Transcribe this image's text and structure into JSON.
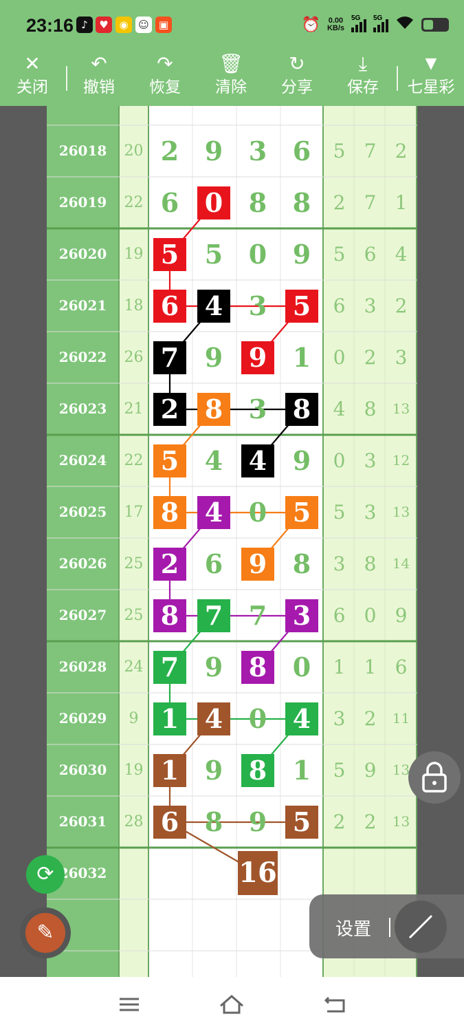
{
  "status_bar": {
    "time": "23:16",
    "net_speed": "0.00",
    "net_unit": "KB/s",
    "sim1": "5G",
    "sim2": "5G",
    "app_icons": [
      "tiktok-icon",
      "heart-app-icon",
      "bell-app-icon",
      "avatar-app-icon",
      "shopping-app-icon"
    ]
  },
  "toolbar": {
    "close": "关闭",
    "undo": "撤销",
    "redo": "恢复",
    "clear": "清除",
    "share": "分享",
    "save": "保存",
    "lottery": "七星彩"
  },
  "chart": {
    "rows": [
      {
        "issue": "26018",
        "sum": "20",
        "digits": [
          "2",
          "9",
          "3",
          "6"
        ],
        "tail": [
          "5",
          "7",
          "2"
        ]
      },
      {
        "issue": "26019",
        "sum": "22",
        "digits": [
          "6",
          "0",
          "8",
          "8"
        ],
        "tail": [
          "2",
          "7",
          "1"
        ]
      },
      {
        "issue": "26020",
        "sum": "19",
        "digits": [
          "5",
          "5",
          "0",
          "9"
        ],
        "tail": [
          "5",
          "6",
          "4"
        ]
      },
      {
        "issue": "26021",
        "sum": "18",
        "digits": [
          "6",
          "4",
          "3",
          "5"
        ],
        "tail": [
          "6",
          "3",
          "2"
        ]
      },
      {
        "issue": "26022",
        "sum": "26",
        "digits": [
          "7",
          "9",
          "9",
          "1"
        ],
        "tail": [
          "0",
          "2",
          "3"
        ]
      },
      {
        "issue": "26023",
        "sum": "21",
        "digits": [
          "2",
          "8",
          "3",
          "8"
        ],
        "tail": [
          "4",
          "8",
          "13"
        ]
      },
      {
        "issue": "26024",
        "sum": "22",
        "digits": [
          "5",
          "4",
          "4",
          "9"
        ],
        "tail": [
          "0",
          "3",
          "12"
        ]
      },
      {
        "issue": "26025",
        "sum": "17",
        "digits": [
          "8",
          "4",
          "0",
          "5"
        ],
        "tail": [
          "5",
          "3",
          "13"
        ]
      },
      {
        "issue": "26026",
        "sum": "25",
        "digits": [
          "2",
          "6",
          "9",
          "8"
        ],
        "tail": [
          "3",
          "8",
          "14"
        ]
      },
      {
        "issue": "26027",
        "sum": "25",
        "digits": [
          "8",
          "7",
          "7",
          "3"
        ],
        "tail": [
          "6",
          "0",
          "9"
        ]
      },
      {
        "issue": "26028",
        "sum": "24",
        "digits": [
          "7",
          "9",
          "8",
          "0"
        ],
        "tail": [
          "1",
          "1",
          "6"
        ]
      },
      {
        "issue": "26029",
        "sum": "9",
        "digits": [
          "1",
          "4",
          "0",
          "4"
        ],
        "tail": [
          "3",
          "2",
          "11"
        ]
      },
      {
        "issue": "26030",
        "sum": "19",
        "digits": [
          "1",
          "9",
          "8",
          "1"
        ],
        "tail": [
          "5",
          "9",
          "13"
        ]
      },
      {
        "issue": "26031",
        "sum": "28",
        "digits": [
          "6",
          "8",
          "9",
          "5"
        ],
        "tail": [
          "2",
          "2",
          "13"
        ]
      },
      {
        "issue": "26032",
        "sum": "",
        "digits": [
          "",
          "",
          "",
          ""
        ],
        "tail": [
          "",
          "",
          ""
        ]
      }
    ],
    "highlights": [
      {
        "row": 1,
        "col": 1,
        "color": "#e8141c"
      },
      {
        "row": 2,
        "col": 0,
        "color": "#e8141c"
      },
      {
        "row": 3,
        "col": 0,
        "color": "#e8141c"
      },
      {
        "row": 3,
        "col": 3,
        "color": "#e8141c"
      },
      {
        "row": 4,
        "col": 2,
        "color": "#e8141c"
      },
      {
        "row": 3,
        "col": 1,
        "color": "#000000"
      },
      {
        "row": 4,
        "col": 0,
        "color": "#000000"
      },
      {
        "row": 5,
        "col": 0,
        "color": "#000000"
      },
      {
        "row": 5,
        "col": 3,
        "color": "#000000"
      },
      {
        "row": 6,
        "col": 2,
        "color": "#000000"
      },
      {
        "row": 5,
        "col": 1,
        "color": "#f77d16"
      },
      {
        "row": 6,
        "col": 0,
        "color": "#f77d16"
      },
      {
        "row": 7,
        "col": 0,
        "color": "#f77d16"
      },
      {
        "row": 7,
        "col": 3,
        "color": "#f77d16"
      },
      {
        "row": 8,
        "col": 2,
        "color": "#f77d16"
      },
      {
        "row": 7,
        "col": 1,
        "color": "#a51aac"
      },
      {
        "row": 8,
        "col": 0,
        "color": "#a51aac"
      },
      {
        "row": 9,
        "col": 0,
        "color": "#a51aac"
      },
      {
        "row": 9,
        "col": 3,
        "color": "#a51aac"
      },
      {
        "row": 10,
        "col": 2,
        "color": "#a51aac"
      },
      {
        "row": 9,
        "col": 1,
        "color": "#26b14a"
      },
      {
        "row": 10,
        "col": 0,
        "color": "#26b14a"
      },
      {
        "row": 11,
        "col": 0,
        "color": "#26b14a"
      },
      {
        "row": 11,
        "col": 3,
        "color": "#26b14a"
      },
      {
        "row": 12,
        "col": 2,
        "color": "#26b14a"
      },
      {
        "row": 11,
        "col": 1,
        "color": "#a0552b"
      },
      {
        "row": 12,
        "col": 0,
        "color": "#a0552b"
      },
      {
        "row": 13,
        "col": 0,
        "color": "#a0552b"
      },
      {
        "row": 13,
        "col": 3,
        "color": "#a0552b"
      }
    ],
    "forecast_value": "16",
    "forecast_color": "#a0552b"
  },
  "overlay": {
    "settings_label": "设置"
  }
}
